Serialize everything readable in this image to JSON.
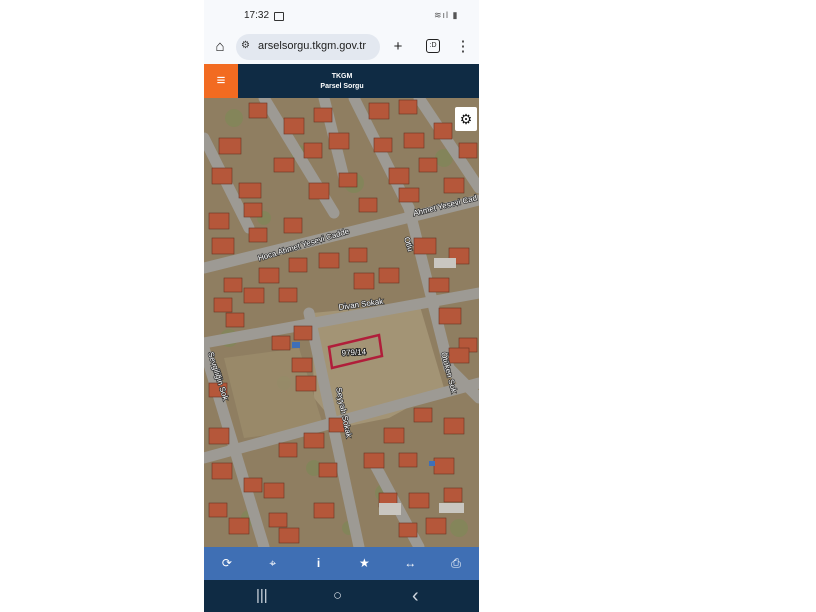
{
  "status_bar": {
    "time": "17:32"
  },
  "browser": {
    "url": "arselsorgu.tkgm.gov.tr",
    "tab_count": ":D",
    "home_icon": "home-icon",
    "new_tab_icon": "plus-icon",
    "menu_icon": "more-vert-icon"
  },
  "app": {
    "title_line1": "TKGM",
    "title_line2": "Parsel Sorgu",
    "menu_icon": "hamburger-icon",
    "settings_icon": "gear-icon"
  },
  "map": {
    "parcel_label": "979/14",
    "parcel_color": "#b01e3a",
    "streets": {
      "hoca": "Hoca Ahmet Yesevi Cadde",
      "ahmet_right": "Ahmet Yesevi Cad",
      "divan": "Divan Sokak",
      "otlu": "Otlu",
      "otuken": "Ötüken Sok",
      "seyyah": "Seyyah Sokak",
      "sevgi": "Sevgiliğin Sok"
    }
  },
  "toolbar": {
    "items": [
      {
        "icon": "refresh-icon",
        "glyph": "⟳"
      },
      {
        "icon": "locate-icon",
        "glyph": "⌖"
      },
      {
        "icon": "info-icon",
        "glyph": "i"
      },
      {
        "icon": "star-icon",
        "glyph": "★"
      },
      {
        "icon": "measure-icon",
        "glyph": "↔"
      },
      {
        "icon": "print-icon",
        "glyph": "⎙"
      }
    ]
  },
  "system_nav": {
    "recents": "|||",
    "home": "○",
    "back": "‹"
  }
}
